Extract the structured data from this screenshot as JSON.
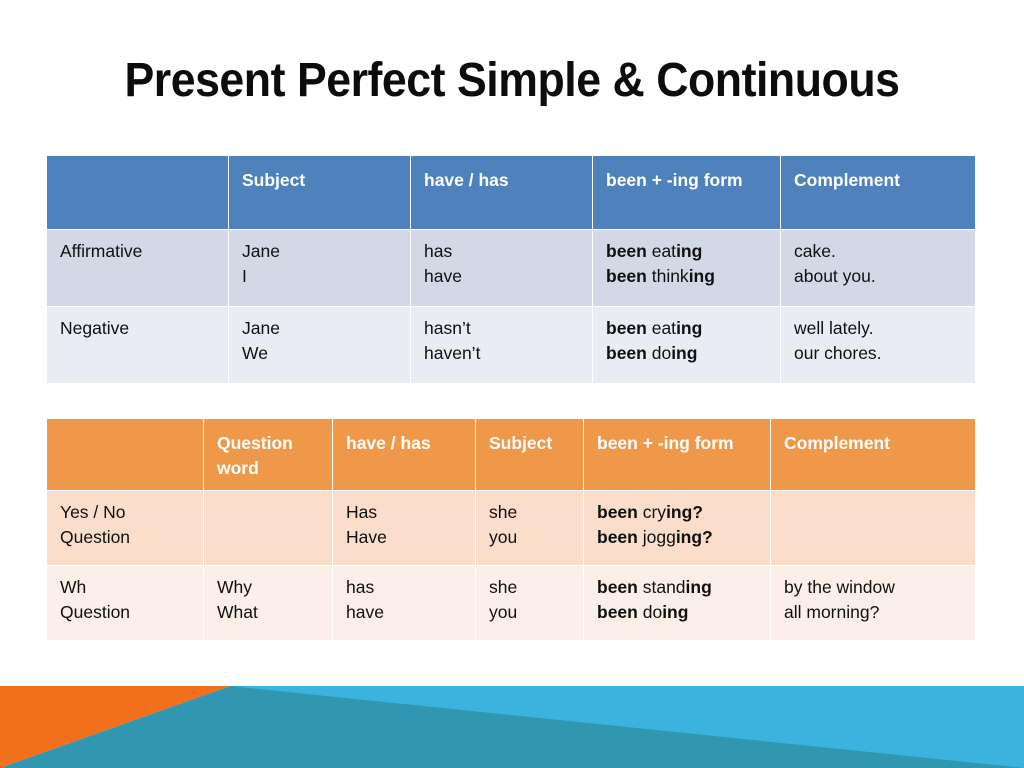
{
  "slide": {
    "title": "Present Perfect Simple & Continuous"
  },
  "table_affirmative_negative": {
    "name": "Present Perfect Continuous statements",
    "header_color": "#4F81BD",
    "headers": [
      "",
      "Subject",
      "have / has",
      "been + -ing form",
      "Complement"
    ],
    "rows": [
      {
        "label": "Affirmative",
        "row_color": "#D2D8E6",
        "subject": [
          "Jane",
          "I"
        ],
        "have_has": [
          "has",
          "have"
        ],
        "been_ing": [
          {
            "bold_prefix": "been",
            "stem": " eat",
            "bold_suffix": "ing"
          },
          {
            "bold_prefix": "been",
            "stem": " think",
            "bold_suffix": "ing"
          }
        ],
        "complement": [
          "cake.",
          "about you."
        ]
      },
      {
        "label": "Negative",
        "row_color": "#E9ECF3",
        "subject": [
          "Jane",
          "We"
        ],
        "have_has": [
          "hasn’t",
          "haven’t"
        ],
        "been_ing": [
          {
            "bold_prefix": "been",
            "stem": " eat",
            "bold_suffix": "ing"
          },
          {
            "bold_prefix": "been",
            "stem": " do",
            "bold_suffix": "ing"
          }
        ],
        "complement": [
          "well lately.",
          "our chores."
        ]
      }
    ]
  },
  "table_questions": {
    "name": "Present Perfect Continuous questions",
    "header_color": "#F0984A",
    "headers": [
      "",
      "Question word",
      "have / has",
      "Subject",
      "been + -ing form",
      "Complement"
    ],
    "rows": [
      {
        "label": "Yes / No Question",
        "label_lines": [
          "Yes / No",
          "Question"
        ],
        "row_color": "#FADDCB",
        "question_word": [
          "",
          ""
        ],
        "have_has": [
          "Has",
          "Have"
        ],
        "subject": [
          "she",
          "you"
        ],
        "been_ing": [
          {
            "bold_prefix": "been",
            "stem": " cry",
            "bold_suffix": "ing?"
          },
          {
            "bold_prefix": "been",
            "stem": " jogg",
            "bold_suffix": "ing?"
          }
        ],
        "complement": [
          "",
          ""
        ]
      },
      {
        "label": "Wh Question",
        "label_lines": [
          "Wh",
          "Question"
        ],
        "row_color": "#FCEFE8",
        "question_word": [
          "Why",
          "What"
        ],
        "have_has": [
          "has",
          "have"
        ],
        "subject": [
          "she",
          "you"
        ],
        "been_ing": [
          {
            "bold_prefix": "been",
            "stem": " stand",
            "bold_suffix": "ing"
          },
          {
            "bold_prefix": "been",
            "stem": " do",
            "bold_suffix": "ing"
          }
        ],
        "complement": [
          "by the window",
          "all morning?"
        ]
      }
    ]
  },
  "footer_decoration": {
    "orange": "#F2701C",
    "teal": "#3196B0",
    "light_blue": "#3BB3DE"
  }
}
